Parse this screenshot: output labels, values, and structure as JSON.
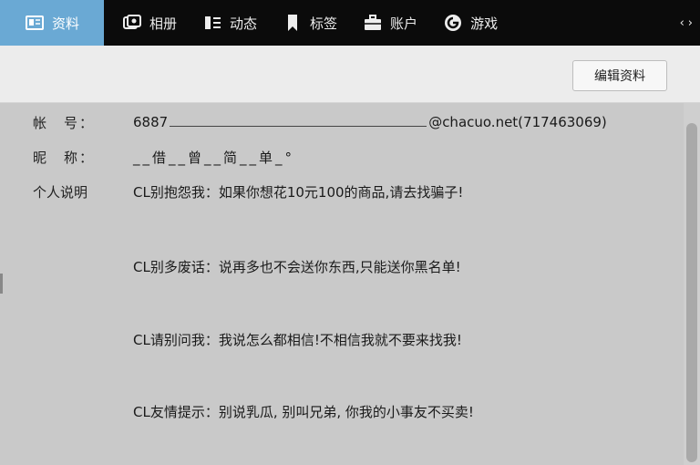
{
  "nav": {
    "tabs": [
      {
        "label": "资料",
        "icon": "profile-card-icon",
        "active": true
      },
      {
        "label": "相册",
        "icon": "photo-album-icon",
        "active": false
      },
      {
        "label": "动态",
        "icon": "activity-list-icon",
        "active": false
      },
      {
        "label": "标签",
        "icon": "bookmark-tag-icon",
        "active": false
      },
      {
        "label": "账户",
        "icon": "briefcase-icon",
        "active": false
      },
      {
        "label": "游戏",
        "icon": "game-icon",
        "active": false
      }
    ],
    "prev_arrow": "‹",
    "next_arrow": "›"
  },
  "toolbar": {
    "edit_label": "编辑资料"
  },
  "profile": {
    "account_label": "帐　号：",
    "account_prefix": "6887",
    "account_suffix": "@chacuo.net(717463069)",
    "nickname_label": "昵　称：",
    "nickname_value": "__借__曾__简__单_°",
    "intro_label": "个人说明",
    "intro_lines": [
      "CL别抱怨我：如果你想花10元100的商品,请去找骗子!",
      "CL别多废话：说再多也不会送你东西,只能送你黑名单!",
      "CL请别问我：我说怎么都相信!不相信我就不要来找我!",
      "CL友情提示：别说乳瓜, 别叫兄弟, 你我的小事友不买卖!"
    ]
  },
  "colors": {
    "topbar": "#0b0b0b",
    "active_tab": "#6aa9d4",
    "content_bg": "#c9c9c9"
  }
}
